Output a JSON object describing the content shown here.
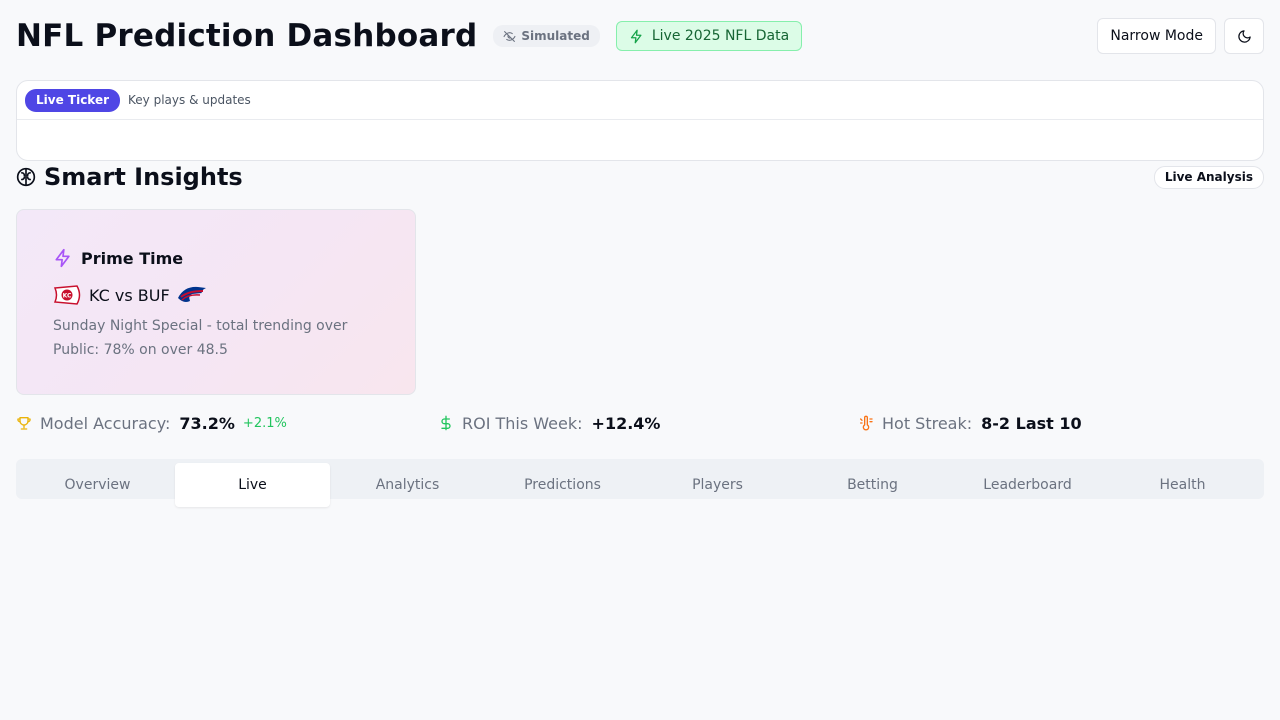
{
  "header": {
    "title": "NFL Prediction Dashboard",
    "simulated_badge": "Simulated",
    "live_data_badge": "Live 2025 NFL Data",
    "narrow_mode_button": "Narrow Mode",
    "theme_icon": "moon-icon"
  },
  "ticker": {
    "label": "Live Ticker",
    "subtitle": "Key plays & updates"
  },
  "insights": {
    "title": "Smart Insights",
    "badge": "Live Analysis",
    "cards": [
      {
        "title": "Prime Time",
        "icon": "lightning-icon",
        "matchup": "KC vs BUF",
        "home_logo": "chiefs-logo",
        "away_logo": "bills-logo",
        "line1": "Sunday Night Special - total trending over",
        "line2": "Public: 78% on over 48.5"
      }
    ]
  },
  "stats": {
    "accuracy": {
      "label": "Model Accuracy:",
      "value": "73.2%",
      "delta": "+2.1%"
    },
    "roi": {
      "label": "ROI This Week:",
      "value": "+12.4%"
    },
    "streak": {
      "label": "Hot Streak:",
      "value": "8-2 Last 10"
    }
  },
  "tabs": [
    {
      "label": "Overview",
      "active": false
    },
    {
      "label": "Live",
      "active": true
    },
    {
      "label": "Analytics",
      "active": false
    },
    {
      "label": "Predictions",
      "active": false
    },
    {
      "label": "Players",
      "active": false
    },
    {
      "label": "Betting",
      "active": false
    },
    {
      "label": "Leaderboard",
      "active": false
    },
    {
      "label": "Health",
      "active": false
    }
  ],
  "colors": {
    "accent": "#4f46e5",
    "live_green": "#166534",
    "positive": "#22c55e",
    "streak_orange": "#f97316",
    "trophy_gold": "#eab308",
    "insight_purple": "#a855f7"
  }
}
